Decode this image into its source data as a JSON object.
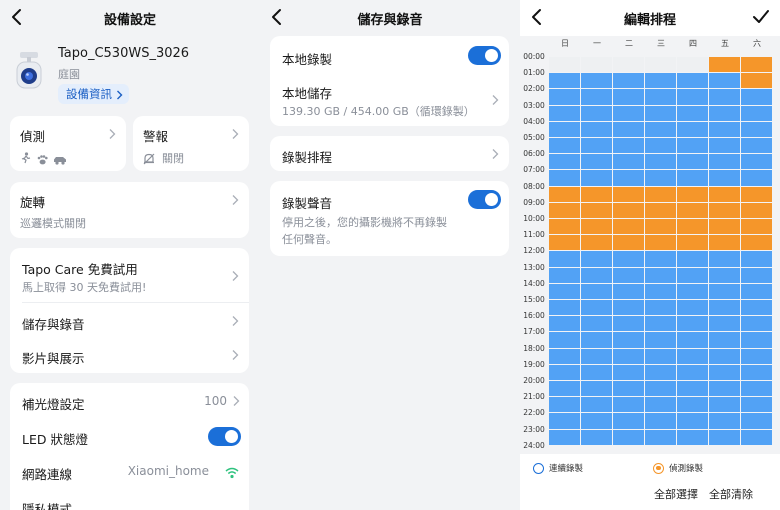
{
  "settings": {
    "title": "設備設定",
    "device_name": "Tapo_C530WS_3026",
    "device_location": "庭園",
    "device_info_button": "設備資訊",
    "detection_label": "偵測",
    "alarm_label": "警報",
    "alarm_status": "關閉",
    "rotation_label": "旋轉",
    "rotation_sub": "巡邏模式關閉",
    "care_title": "Tapo Care 免費試用",
    "care_sub": "馬上取得 30 天免費試用!",
    "storage_label": "儲存與錄音",
    "video_label": "影片與展示",
    "fill_light_label": "補光燈設定",
    "fill_light_value": "100",
    "led_label": "LED 狀態燈",
    "network_label": "網路連線",
    "network_value": "Xiaomi_home",
    "privacy_label": "隱私模式"
  },
  "storage": {
    "title": "儲存與錄音",
    "local_record_label": "本地錄製",
    "local_storage_label": "本地儲存",
    "local_storage_value": "139.30 GB / 454.00 GB（循環錄製）",
    "schedule_label": "錄製排程",
    "audio_label": "錄製聲音",
    "audio_desc_line1": "停用之後，您的攝影機將不再錄製",
    "audio_desc_line2": "任何聲音。"
  },
  "schedule": {
    "title": "編輯排程",
    "days": [
      "日",
      "一",
      "二",
      "三",
      "四",
      "五",
      "六"
    ],
    "hours": [
      "00:00",
      "01:00",
      "02:00",
      "03:00",
      "04:00",
      "05:00",
      "06:00",
      "07:00",
      "08:00",
      "09:00",
      "10:00",
      "11:00",
      "12:00",
      "13:00",
      "14:00",
      "15:00",
      "16:00",
      "17:00",
      "18:00",
      "19:00",
      "20:00",
      "21:00",
      "22:00",
      "23:00",
      "24:00"
    ],
    "legend_continuous": "連續錄製",
    "legend_motion": "偵測錄製",
    "select_all": "全部選擇",
    "clear_all": "全部清除",
    "colors": {
      "continuous": "#52a2f5",
      "motion": "#f5962a",
      "empty": "#eef0f2",
      "accent": "#1b6fd8"
    },
    "grid": [
      "EEEEEMM",
      "CCCCCCM",
      "CCCCCCC",
      "CCCCCCC",
      "CCCCCCC",
      "CCCCCCC",
      "CCCCCCC",
      "CCCCCCC",
      "MMMMMMM",
      "MMMMMMM",
      "MMMMMMM",
      "MMMMMMM",
      "CCCCCCC",
      "CCCCCCC",
      "CCCCCCC",
      "CCCCCCC",
      "CCCCCCC",
      "CCCCCCC",
      "CCCCCCC",
      "CCCCCCC",
      "CCCCCCC",
      "CCCCCCC",
      "CCCCCCC",
      "CCCCCCC"
    ]
  }
}
